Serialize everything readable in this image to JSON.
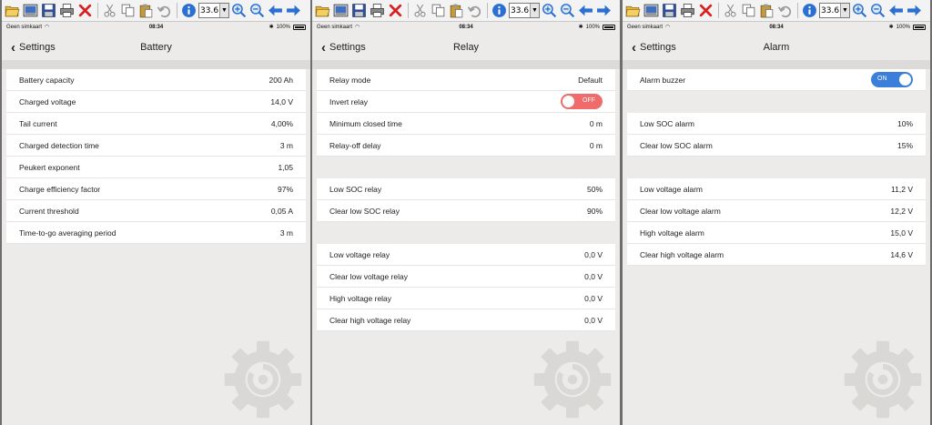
{
  "toolbar": {
    "icons": [
      "open-folder-icon",
      "image-icon",
      "save-icon",
      "print-icon",
      "delete-icon",
      "cut-icon",
      "copy-icon",
      "paste-icon",
      "undo-icon",
      "info-icon",
      "zoom-in-icon",
      "zoom-out-icon",
      "back-arrow-icon",
      "forward-arrow-icon"
    ],
    "zoom_value": "33.6",
    "colors": {
      "delete": "#d82020",
      "info": "#2a6fd1",
      "arrow": "#2a6fd1"
    }
  },
  "status": {
    "carrier": "Geen simkaart",
    "time": "08:34",
    "battery": "100%"
  },
  "panels": [
    {
      "back_label": "Settings",
      "title": "Battery",
      "rows": [
        {
          "label": "Battery capacity",
          "value": "200 Ah"
        },
        {
          "label": "Charged voltage",
          "value": "14,0 V"
        },
        {
          "label": "Tail current",
          "value": "4,00%"
        },
        {
          "label": "Charged detection time",
          "value": "3 m"
        },
        {
          "label": "Peukert exponent",
          "value": "1,05"
        },
        {
          "label": "Charge efficiency factor",
          "value": "97%"
        },
        {
          "label": "Current threshold",
          "value": "0,05 A"
        },
        {
          "label": "Time-to-go averaging period",
          "value": "3 m"
        }
      ]
    },
    {
      "back_label": "Settings",
      "title": "Relay",
      "rows": [
        {
          "label": "Relay mode",
          "value": "Default"
        },
        {
          "label": "Invert relay",
          "toggle": "OFF"
        },
        {
          "label": "Minimum closed time",
          "value": "0 m"
        },
        {
          "label": "Relay-off delay",
          "value": "0 m"
        },
        {
          "gap": true
        },
        {
          "label": "Low SOC relay",
          "value": "50%"
        },
        {
          "label": "Clear low SOC relay",
          "value": "90%"
        },
        {
          "gap": true
        },
        {
          "label": "Low voltage relay",
          "value": "0,0 V"
        },
        {
          "label": "Clear low voltage relay",
          "value": "0,0 V"
        },
        {
          "label": "High voltage relay",
          "value": "0,0 V"
        },
        {
          "label": "Clear high voltage relay",
          "value": "0,0 V"
        }
      ]
    },
    {
      "back_label": "Settings",
      "title": "Alarm",
      "rows": [
        {
          "label": "Alarm buzzer",
          "toggle": "ON"
        },
        {
          "gap": true
        },
        {
          "label": "Low SOC alarm",
          "value": "10%"
        },
        {
          "label": "Clear low SOC alarm",
          "value": "15%"
        },
        {
          "gap": true
        },
        {
          "label": "Low voltage alarm",
          "value": "11,2 V"
        },
        {
          "label": "Clear low voltage alarm",
          "value": "12,2 V"
        },
        {
          "label": "High voltage alarm",
          "value": "15,0 V"
        },
        {
          "label": "Clear high voltage alarm",
          "value": "14,6 V"
        }
      ]
    }
  ],
  "colors": {
    "toggle_on": "#3b7fdb",
    "toggle_off": "#f06b6b",
    "background": "#ecebe9"
  }
}
